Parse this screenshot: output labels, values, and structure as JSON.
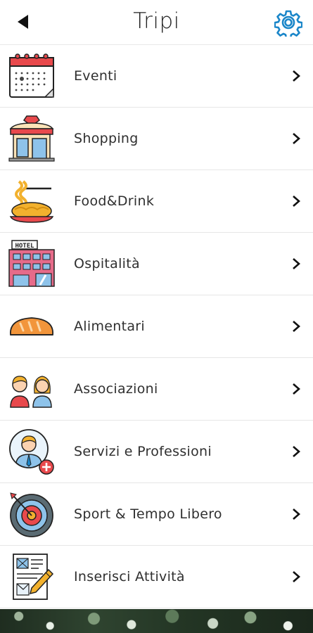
{
  "header": {
    "title": "Tripi",
    "back_icon": "back-arrow-icon",
    "settings_icon": "gear-icon"
  },
  "colors": {
    "accent": "#1a86c9",
    "chevron": "#111111",
    "divider": "#e6e6e6"
  },
  "menu": [
    {
      "label": "Eventi",
      "icon": "calendar-icon"
    },
    {
      "label": "Shopping",
      "icon": "shop-icon"
    },
    {
      "label": "Food&Drink",
      "icon": "spaghetti-icon"
    },
    {
      "label": "Ospitalità",
      "icon": "hotel-icon"
    },
    {
      "label": "Alimentari",
      "icon": "bread-icon"
    },
    {
      "label": "Associazioni",
      "icon": "people-icon"
    },
    {
      "label": "Servizi e Professioni",
      "icon": "professional-icon"
    },
    {
      "label": "Sport & Tempo Libero",
      "icon": "target-icon"
    },
    {
      "label": "Inserisci Attività",
      "icon": "edit-document-icon"
    }
  ]
}
